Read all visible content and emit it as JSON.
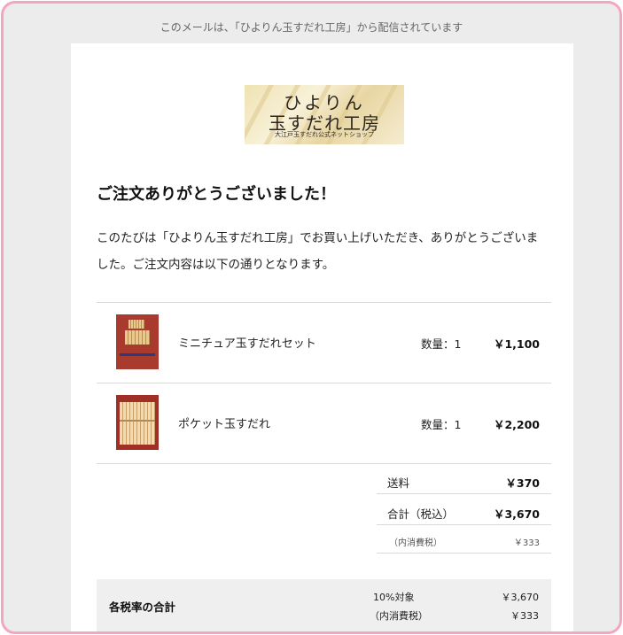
{
  "notice": "このメールは、「ひよりん玉すだれ工房」から配信されています",
  "logo": {
    "line1": "ひよりん",
    "line2": "玉すだれ工房",
    "line3": "大江戸玉すだれ公式ネットショップ"
  },
  "heading": "ご注文ありがとうございました！",
  "intro": "このたびは「ひよりん玉すだれ工房」でお買い上げいただき、ありがとうございました。ご注文内容は以下の通りとなります。",
  "items": [
    {
      "name": "ミニチュア玉すだれセット",
      "qty": "数量：1",
      "price": "￥1,100"
    },
    {
      "name": "ポケット玉すだれ",
      "qty": "数量：1",
      "price": "￥2,200"
    }
  ],
  "summary": {
    "shipping_label": "送料",
    "shipping_value": "￥370",
    "total_label": "合計（税込）",
    "total_value": "￥3,670",
    "tax_label": "（内消費税）",
    "tax_value": "￥333"
  },
  "tax_breakdown": {
    "title": "各税率の合計",
    "rate_label": "10%対象",
    "rate_value": "￥3,670",
    "tax_label": "（内消費税）",
    "tax_value": "￥333"
  },
  "colors": {
    "frame_border": "#f4a6c0",
    "outer_background": "#ececec",
    "card_background": "#ffffff",
    "tax_box_background": "#efefef"
  }
}
